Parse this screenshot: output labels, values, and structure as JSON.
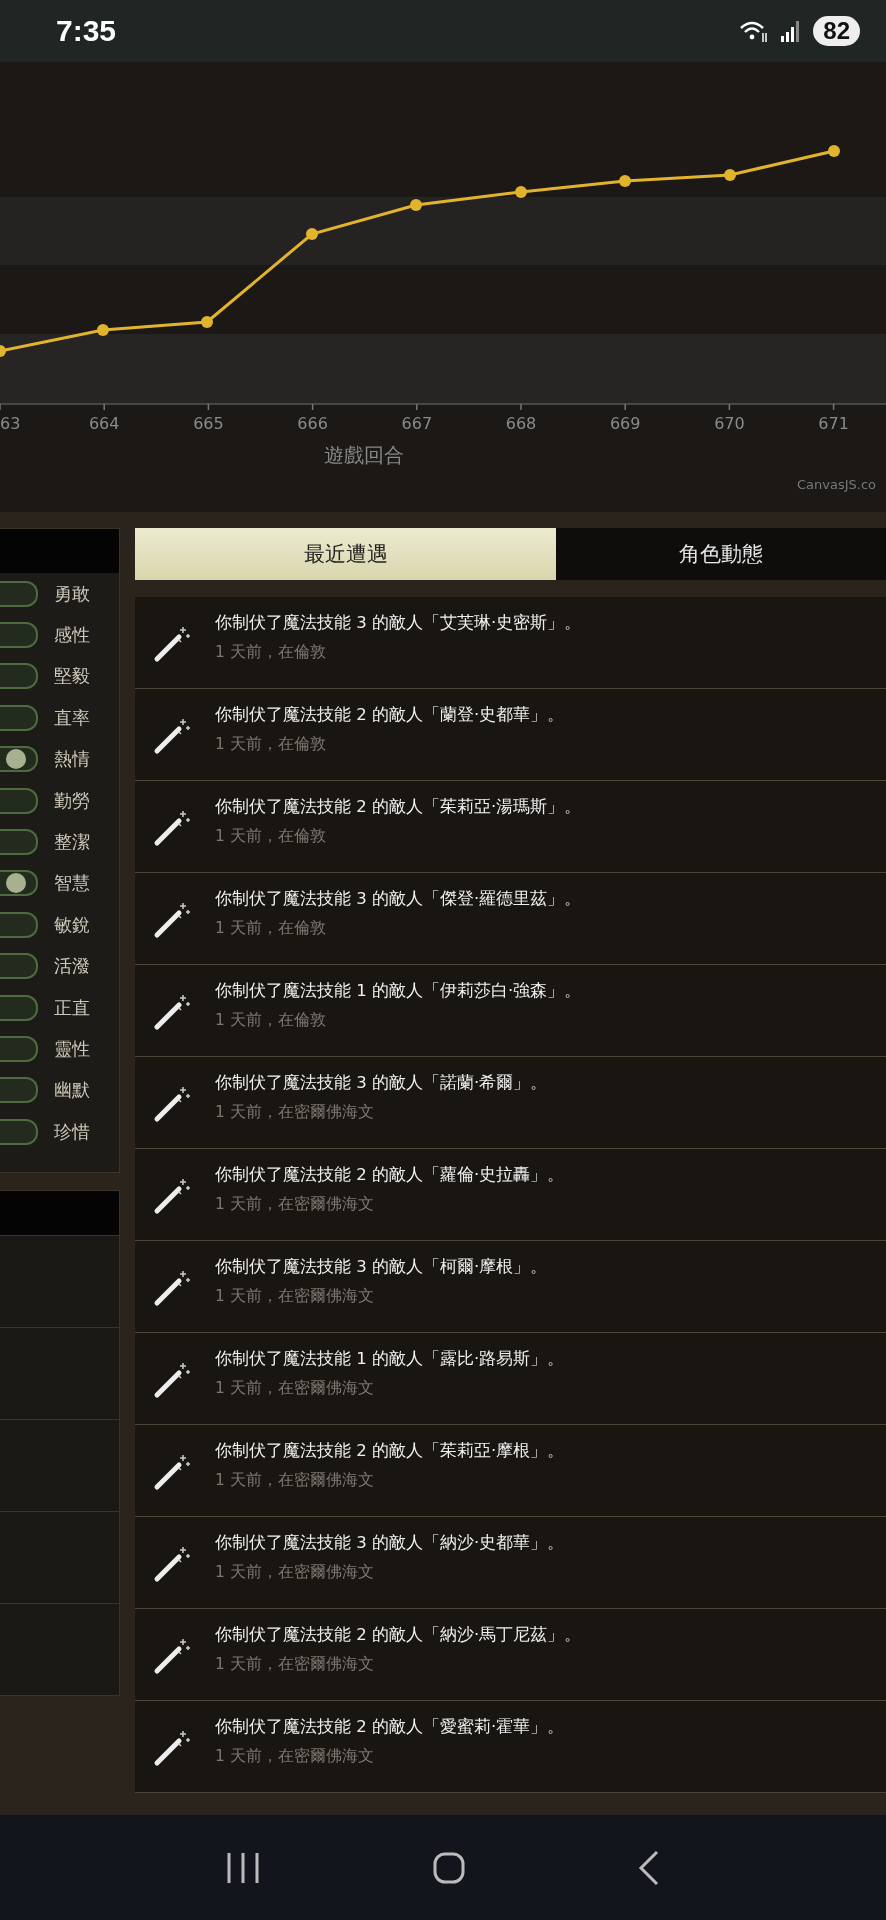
{
  "status_bar": {
    "time": "7:35",
    "battery": "82"
  },
  "chart": {
    "x_labels": [
      "63",
      "664",
      "665",
      "666",
      "667",
      "668",
      "669",
      "670",
      "671"
    ],
    "axis_title": "遊戲回合",
    "credit": "CanvasJS.co"
  },
  "traits": [
    {
      "label": "勇敢",
      "on": false
    },
    {
      "label": "感性",
      "on": false
    },
    {
      "label": "堅毅",
      "on": false
    },
    {
      "label": "直率",
      "on": false
    },
    {
      "label": "熱情",
      "on": true
    },
    {
      "label": "勤勞",
      "on": false
    },
    {
      "label": "整潔",
      "on": false
    },
    {
      "label": "智慧",
      "on": true
    },
    {
      "label": "敏銳",
      "on": false
    },
    {
      "label": "活潑",
      "on": false
    },
    {
      "label": "正直",
      "on": false
    },
    {
      "label": "靈性",
      "on": false
    },
    {
      "label": "幽默",
      "on": false
    },
    {
      "label": "珍惜",
      "on": false
    }
  ],
  "tabs": [
    {
      "label": "最近遭遇",
      "selected": true
    },
    {
      "label": "角色動態",
      "selected": false
    }
  ],
  "encounters": [
    {
      "text": "你制伏了魔法技能 3 的敵人「艾芙琳·史密斯」。",
      "meta": "1 天前，在倫敦"
    },
    {
      "text": "你制伏了魔法技能 2 的敵人「蘭登·史都華」。",
      "meta": "1 天前，在倫敦"
    },
    {
      "text": "你制伏了魔法技能 2 的敵人「茱莉亞·湯瑪斯」。",
      "meta": "1 天前，在倫敦"
    },
    {
      "text": "你制伏了魔法技能 3 的敵人「傑登·羅德里茲」。",
      "meta": "1 天前，在倫敦"
    },
    {
      "text": "你制伏了魔法技能 1 的敵人「伊莉莎白·強森」。",
      "meta": "1 天前，在倫敦"
    },
    {
      "text": "你制伏了魔法技能 3 的敵人「諾蘭·希爾」。",
      "meta": "1 天前，在密爾佛海文"
    },
    {
      "text": "你制伏了魔法技能 2 的敵人「蘿倫·史拉轟」。",
      "meta": "1 天前，在密爾佛海文"
    },
    {
      "text": "你制伏了魔法技能 3 的敵人「柯爾·摩根」。",
      "meta": "1 天前，在密爾佛海文"
    },
    {
      "text": "你制伏了魔法技能 1 的敵人「露比·路易斯」。",
      "meta": "1 天前，在密爾佛海文"
    },
    {
      "text": "你制伏了魔法技能 2 的敵人「茱莉亞·摩根」。",
      "meta": "1 天前，在密爾佛海文"
    },
    {
      "text": "你制伏了魔法技能 3 的敵人「納沙·史都華」。",
      "meta": "1 天前，在密爾佛海文"
    },
    {
      "text": "你制伏了魔法技能 2 的敵人「納沙·馬丁尼茲」。",
      "meta": "1 天前，在密爾佛海文"
    },
    {
      "text": "你制伏了魔法技能 2 的敵人「愛蜜莉·霍華」。",
      "meta": "1 天前，在密爾佛海文"
    }
  ]
}
